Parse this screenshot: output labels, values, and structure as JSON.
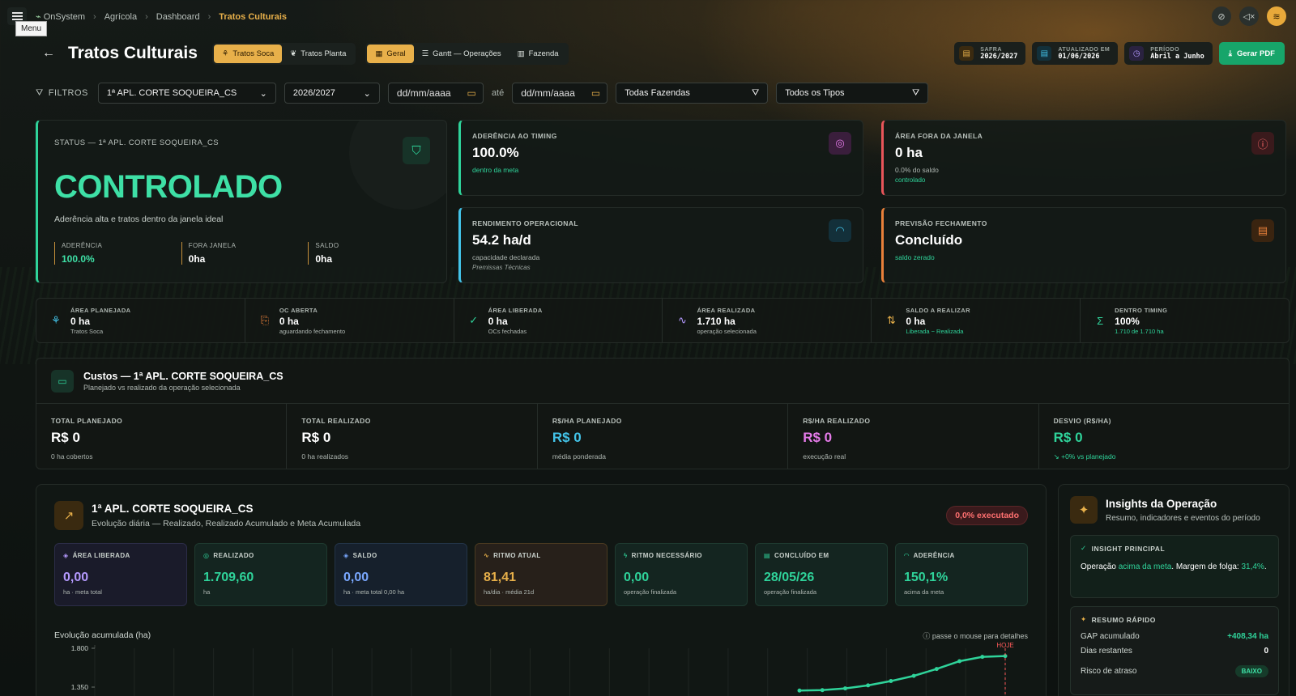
{
  "topbar": {
    "menu_tooltip": "Menu",
    "breadcrumb": [
      "OnSystem",
      "Agrícola",
      "Dashboard",
      "Tratos Culturais"
    ]
  },
  "header": {
    "title": "Tratos Culturais",
    "seg1": [
      "Tratos Soca",
      "Tratos Planta"
    ],
    "seg2": [
      "Geral",
      "Gantt — Operações",
      "Fazenda"
    ],
    "safra_label": "SAFRA",
    "safra_value": "2026/2027",
    "atualizado_label": "ATUALIZADO EM",
    "atualizado_value": "01/06/2026",
    "periodo_label": "PERÍODO",
    "periodo_value": "Abril a Junho",
    "pdf_button": "Gerar PDF"
  },
  "filters": {
    "label": "FILTROS",
    "operacao": "1ª APL. CORTE SOQUEIRA_CS",
    "safra": "2026/2027",
    "date_from": "dd/mm/aaaa",
    "ate": "até",
    "date_to": "dd/mm/aaaa",
    "fazendas": "Todas Fazendas",
    "tipos": "Todos os Tipos"
  },
  "status": {
    "label": "STATUS — 1ª APL. CORTE SOQUEIRA_CS",
    "value": "CONTROLADO",
    "desc": "Aderência alta e tratos dentro da janela ideal",
    "stats": [
      {
        "label": "ADERÊNCIA",
        "value": "100.0%"
      },
      {
        "label": "FORA JANELA",
        "value": "0ha"
      },
      {
        "label": "SALDO",
        "value": "0ha"
      }
    ]
  },
  "kpis": {
    "aderencia": {
      "label": "ADERÊNCIA AO TIMING",
      "value": "100.0%",
      "sub": "dentro da meta"
    },
    "fora": {
      "label": "ÁREA FORA DA JANELA",
      "value": "0 ha",
      "sub": "0.0% do saldo",
      "sub2": "controlado"
    },
    "rendimento": {
      "label": "RENDIMENTO OPERACIONAL",
      "value": "54.2 ha/d",
      "sub": "capacidade declarada",
      "sub2": "Premissas Técnicas"
    },
    "previsao": {
      "label": "PREVISÃO FECHAMENTO",
      "value": "Concluído",
      "sub": "saldo zerado"
    }
  },
  "strip": [
    {
      "label": "ÁREA PLANEJADA",
      "value": "0 ha",
      "sub": "Tratos Soca"
    },
    {
      "label": "OC ABERTA",
      "value": "0 ha",
      "sub": "aguardando fechamento"
    },
    {
      "label": "ÁREA LIBERADA",
      "value": "0 ha",
      "sub": "OCs fechadas"
    },
    {
      "label": "ÁREA REALIZADA",
      "value": "1.710 ha",
      "sub": "operação selecionada"
    },
    {
      "label": "SALDO A REALIZAR",
      "value": "0 ha",
      "sub": "Liberada − Realizada"
    },
    {
      "label": "DENTRO TIMING",
      "value": "100%",
      "sub": "1.710 de 1.710 ha"
    }
  ],
  "costs": {
    "title": "Custos — 1ª APL. CORTE SOQUEIRA_CS",
    "subtitle": "Planejado vs realizado da operação selecionada",
    "cells": [
      {
        "label": "TOTAL PLANEJADO",
        "value": "R$ 0",
        "note": "0 ha cobertos"
      },
      {
        "label": "TOTAL REALIZADO",
        "value": "R$ 0",
        "note": "0 ha realizados"
      },
      {
        "label": "R$/HA PLANEJADO",
        "value": "R$ 0",
        "note": "média ponderada"
      },
      {
        "label": "R$/HA REALIZADO",
        "value": "R$ 0",
        "note": "execução real"
      },
      {
        "label": "DESVIO (R$/HA)",
        "value": "R$ 0",
        "note": "↘ +0% vs planejado"
      }
    ]
  },
  "panel": {
    "title": "1ª APL. CORTE SOQUEIRA_CS",
    "subtitle": "Evolução diária — Realizado, Realizado Acumulado e Meta Acumulada",
    "badge": "0,0% executado",
    "metrics": [
      {
        "label": "ÁREA LIBERADA",
        "value": "0,00",
        "sub": "ha · meta total"
      },
      {
        "label": "REALIZADO",
        "value": "1.709,60",
        "sub": "ha"
      },
      {
        "label": "SALDO",
        "value": "0,00",
        "sub": "ha · meta total 0,00 ha"
      },
      {
        "label": "RITMO ATUAL",
        "value": "81,41",
        "sub": "ha/dia · média 21d"
      },
      {
        "label": "RITMO NECESSÁRIO",
        "value": "0,00",
        "sub": "operação finalizada"
      },
      {
        "label": "CONCLUÍDO EM",
        "value": "28/05/26",
        "sub": "operação finalizada"
      },
      {
        "label": "ADERÊNCIA",
        "value": "150,1%",
        "sub": "acima da meta"
      }
    ],
    "chart_label": "Evolução acumulada (ha)",
    "chart_hint": "passe o mouse para detalhes",
    "today_label": "HOJE"
  },
  "chart_data": {
    "type": "line",
    "title": "Evolução acumulada (ha)",
    "ylabel": "",
    "y_ticks": [
      "1.800",
      "1.350"
    ],
    "ylim": [
      1350,
      1800
    ],
    "series": [
      {
        "values": [
          1310,
          1315,
          1335,
          1370,
          1420,
          1480,
          1560,
          1650,
          1700,
          1710
        ]
      }
    ]
  },
  "insights": {
    "title": "Insights da Operação",
    "subtitle": "Resumo, indicadores e eventos do período",
    "principal_label": "INSIGHT PRINCIPAL",
    "principal_pre": "Operação ",
    "principal_hl": "acima da meta",
    "principal_mid": ". Margem de folga: ",
    "principal_hl2": "31,4%",
    "principal_end": ".",
    "resumo_label": "RESUMO RÁPIDO",
    "gap_label": "GAP acumulado",
    "gap_value": "+408,34 ha",
    "dias_label": "Dias restantes",
    "dias_value": "0",
    "risco_label": "Risco de atraso",
    "risco_value": "BAIXO"
  }
}
